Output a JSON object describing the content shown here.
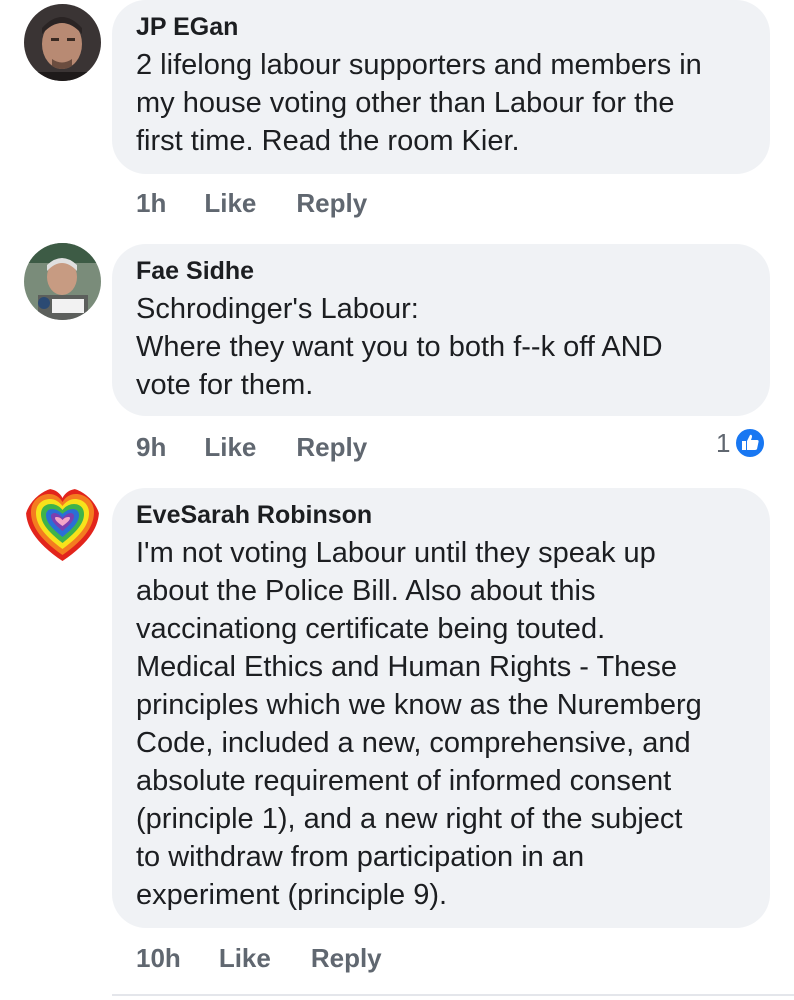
{
  "comments": [
    {
      "author": "JP EGan",
      "text": "2 lifelong labour supporters and members in\nmy house voting other than Labour for the\nfirst time. Read the room Kier.",
      "time": "1h",
      "like_label": "Like",
      "reply_label": "Reply",
      "avatar_icon": "user-photo-icon"
    },
    {
      "author": "Fae Sidhe",
      "text": "Schrodinger's Labour:\nWhere they want you to both f--k off AND\nvote for them.",
      "time": "9h",
      "like_label": "Like",
      "reply_label": "Reply",
      "reaction_count": "1",
      "reaction_icon": "thumbs-up-icon",
      "avatar_icon": "user-photo-icon"
    },
    {
      "author": "EveSarah Robinson",
      "text": "I'm not voting Labour until they speak up\nabout the Police Bill.  Also about this\nvaccinationg certificate being touted.\nMedical Ethics and Human Rights - These\nprinciples which we know as the Nuremberg\nCode, included a new, comprehensive, and\nabsolute requirement of informed consent\n(principle 1), and a new right of the subject\nto withdraw from participation in an\nexperiment (principle 9).",
      "time": "10h",
      "like_label": "Like",
      "reply_label": "Reply",
      "avatar_icon": "rainbow-heart-icon"
    }
  ],
  "colors": {
    "bubble": "#f0f2f5",
    "meta_text": "#606770",
    "like_blue": "#1877f2"
  }
}
